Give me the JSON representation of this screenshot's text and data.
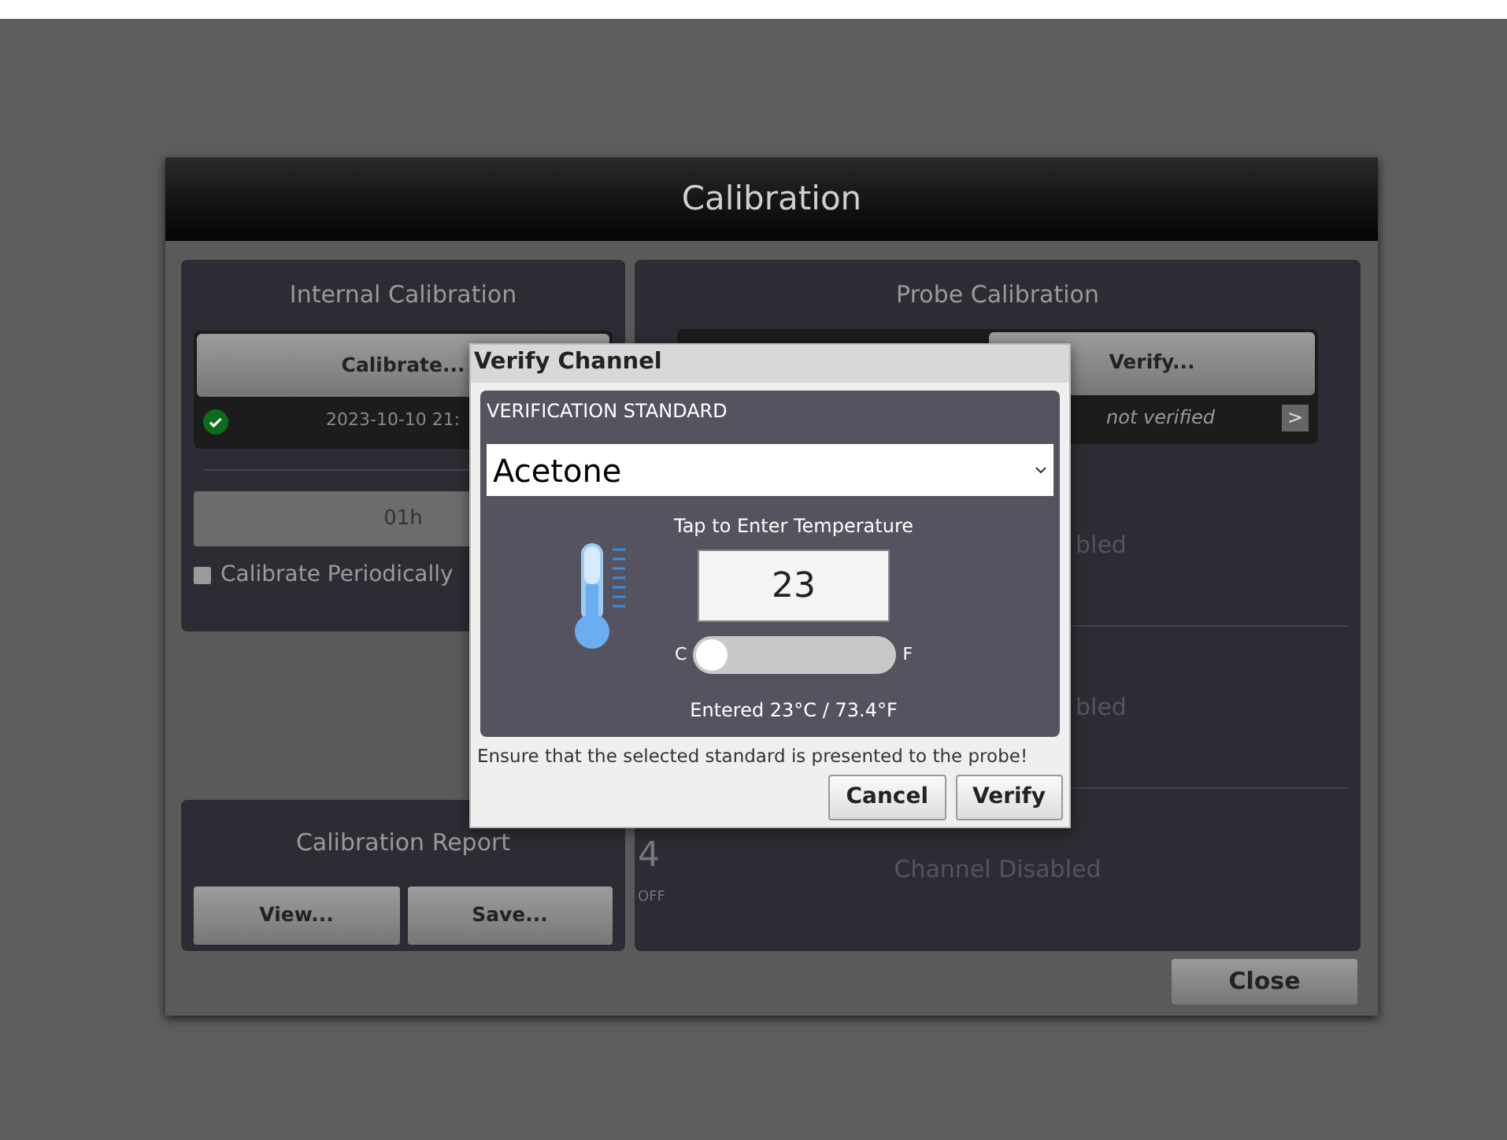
{
  "window": {
    "title": "Calibration"
  },
  "internal": {
    "title": "Internal Calibration",
    "button": "Calibrate...",
    "status": {
      "kind": "ok",
      "text": "2023-10-10 21:"
    },
    "interval": "01h",
    "periodic": {
      "label": "Calibrate Periodically",
      "checked": false
    }
  },
  "report": {
    "title": "Calibration Report",
    "buttons": [
      "View...",
      "Save..."
    ]
  },
  "probe": {
    "title": "Probe Calibration",
    "button": "Verify...",
    "status": {
      "kind": "none",
      "text": "not verified",
      "arrow": ">"
    },
    "channels": [
      {
        "text": "bled"
      },
      {
        "text": "bled"
      },
      {
        "number": "4",
        "state": "OFF",
        "text": "Channel Disabled"
      }
    ]
  },
  "close_button": "Close",
  "dialog": {
    "title": "Verify Channel",
    "section": "VERIFICATION STANDARD",
    "standard": "Acetone",
    "prompt": "Tap to Enter Temperature",
    "temperature": "23",
    "unit_toggle": {
      "left": "C",
      "right": "F",
      "on": false
    },
    "entered": "Entered 23°C / 73.4°F",
    "note": "Ensure that the selected standard is presented to the probe!",
    "buttons": [
      "Cancel",
      "Verify"
    ]
  }
}
